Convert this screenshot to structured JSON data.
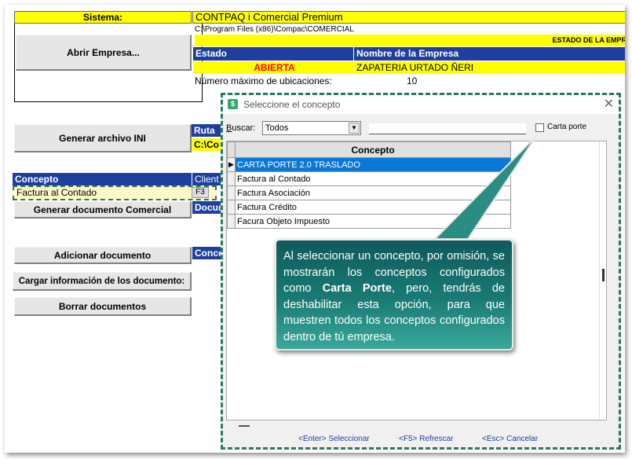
{
  "sheet": {
    "sistema_label": "Sistema:",
    "sistema_value": "CONTPAQ i Comercial Premium",
    "path": "C:\\Program Files (x86)\\Compac\\COMERCIAL",
    "abrir_empresa": "Abrir Empresa...",
    "estado_header": "ESTADO DE LA EMPRE",
    "estado_col": "Estado",
    "nombre_col": "Nombre de la Empresa",
    "estado_value": "ABIERTA",
    "nombre_value": "ZAPATERIA URTADO ÑERI",
    "max_ubic_label": "Número máximo de ubicaciones:",
    "max_ubic_value": "10",
    "generar_ini": "Generar archivo INI",
    "ruta_label": "Ruta",
    "ruta_value": "C:\\Co",
    "concepto_label": "Concepto",
    "cliente_label": "Client",
    "concepto_value": "Factura al Contado",
    "f3": "F3",
    "docu_label": "Docur",
    "generar_doc": "Generar documento Comercial",
    "adicionar_doc": "Adicionar documento",
    "conce_label": "Conce",
    "cargar_info": "Cargar información de los documento:",
    "borrar_docs": "Borrar documentos",
    "estado_color": "#ff0000"
  },
  "dialog": {
    "title": "Seleccione el concepto",
    "buscar_label": "Buscar:",
    "buscar_value": "Todos",
    "carta_porte_label": "Carta porte",
    "carta_porte_checked": false,
    "grid_header": "Concepto",
    "rows": [
      {
        "label": "CARTA PORTE 2.0 TRASLADO",
        "selected": true
      },
      {
        "label": "Factura al Contado",
        "selected": false
      },
      {
        "label": "Factura Asociación",
        "selected": false
      },
      {
        "label": "Factura Crédito",
        "selected": false
      },
      {
        "label": "Facura Objeto Impuesto",
        "selected": false
      }
    ],
    "footer": {
      "enter": "<Enter> Seleccionar",
      "f5": "<F5> Refrescar",
      "esc": "<Esc> Cancelar"
    }
  },
  "callout": {
    "part1": "Al seleccionar un concepto, por omisión, se mostrarán los conceptos configurados como ",
    "bold": "Carta Porte",
    "part2": ", pero, tendrás de deshabilitar esta opción, para que muestren todos los conceptos configurados dentro de tú empresa."
  },
  "colors": {
    "accent_blue": "#1f3f9f",
    "highlight_yellow": "#ffff00",
    "selection_blue": "#0a78d7",
    "callout_teal": "#1a7b74"
  }
}
